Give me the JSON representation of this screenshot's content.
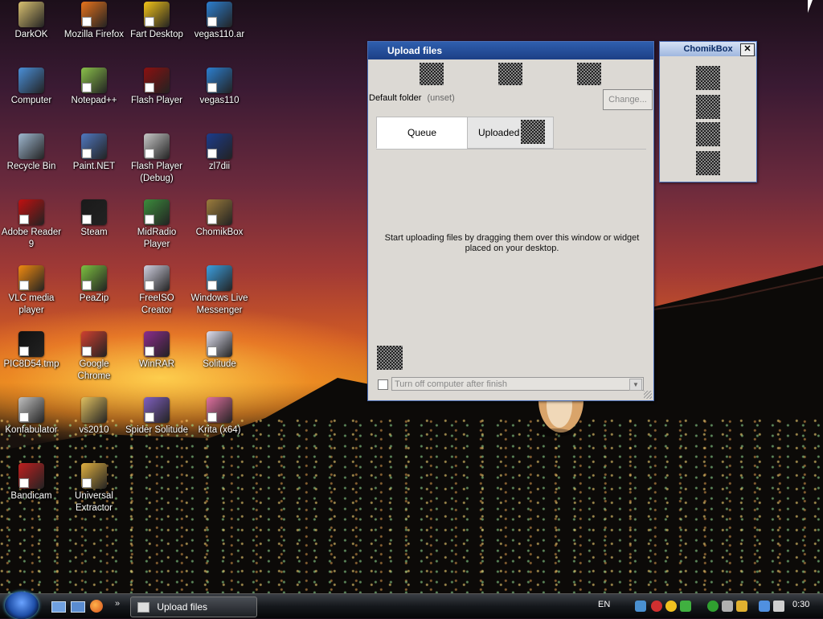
{
  "desktop": {
    "icons": [
      {
        "label": "DarkOK",
        "icon": "folder-zip-icon",
        "color": "#d8c070"
      },
      {
        "label": "Mozilla Firefox",
        "icon": "firefox-icon",
        "color": "#e8731c"
      },
      {
        "label": "Fart Desktop",
        "icon": "smiley-icon",
        "color": "#f2c318"
      },
      {
        "label": "vegas110.ar",
        "icon": "vegas-icon",
        "color": "#2c7fd0"
      },
      {
        "label": "Computer",
        "icon": "computer-icon",
        "color": "#4a8fd8"
      },
      {
        "label": "Notepad++",
        "icon": "notepad-icon",
        "color": "#8ac04a"
      },
      {
        "label": "Flash Player",
        "icon": "flash-icon",
        "color": "#8b1010"
      },
      {
        "label": "vegas110",
        "icon": "vegas-icon",
        "color": "#2c7fd0"
      },
      {
        "label": "Recycle Bin",
        "icon": "recycle-bin-icon",
        "color": "#9fb8d0"
      },
      {
        "label": "Paint.NET",
        "icon": "paint-icon",
        "color": "#5078c0"
      },
      {
        "label": "Flash Player (Debug)",
        "icon": "flash-debug-icon",
        "color": "#c8c8c8"
      },
      {
        "label": "zl7dii",
        "icon": "flash-file-icon",
        "color": "#1c3c8c"
      },
      {
        "label": "Adobe Reader 9",
        "icon": "adobe-reader-icon",
        "color": "#c01010"
      },
      {
        "label": "Steam",
        "icon": "steam-icon",
        "color": "#1a1a1a"
      },
      {
        "label": "MidRadio Player",
        "icon": "radio-icon",
        "color": "#3c8c3c"
      },
      {
        "label": "ChomikBox",
        "icon": "hamster-icon",
        "color": "#9c7c3c"
      },
      {
        "label": "VLC media player",
        "icon": "vlc-icon",
        "color": "#f08a10"
      },
      {
        "label": "PeaZip",
        "icon": "peazip-icon",
        "color": "#7cc040"
      },
      {
        "label": "FreeISO Creator",
        "icon": "iso-icon",
        "color": "#d0d0e0"
      },
      {
        "label": "Windows Live Messenger",
        "icon": "messenger-icon",
        "color": "#3ca0e0"
      },
      {
        "label": "PIC8D54.tmp",
        "icon": "tmp-file-icon",
        "color": "#101010"
      },
      {
        "label": "Google Chrome",
        "icon": "chrome-icon",
        "color": "#d04030"
      },
      {
        "label": "WinRAR",
        "icon": "winrar-icon",
        "color": "#8c2c8c"
      },
      {
        "label": "Solitude",
        "icon": "solitaire-icon",
        "color": "#e0e0f0"
      },
      {
        "label": "Konfabulator",
        "icon": "konfabulator-icon",
        "color": "#c0c0c0"
      },
      {
        "label": "vs2010",
        "icon": "folder-icon",
        "color": "#e0c060"
      },
      {
        "label": "Spider Solitude",
        "icon": "spider-icon",
        "color": "#8060c0"
      },
      {
        "label": "Krita (x64)",
        "icon": "krita-icon",
        "color": "#e070a0"
      },
      {
        "label": "Bandicam",
        "icon": "bandicam-icon",
        "color": "#c02020"
      },
      {
        "label": "Universal Extractor",
        "icon": "extractor-icon",
        "color": "#e0b040"
      }
    ]
  },
  "upload_window": {
    "title": "Upload files",
    "default_folder_label": "Default folder",
    "default_folder_value": "(unset)",
    "change_button": "Change...",
    "tabs": {
      "queue": "Queue",
      "uploaded": "Uploaded"
    },
    "message": "Start uploading files by dragging them over this window or widget placed on your desktop.",
    "shutdown_placeholder": "Turn off computer after finish"
  },
  "widget": {
    "title": "ChomikBox"
  },
  "taskbar": {
    "task_label": "Upload files",
    "language": "EN",
    "clock": "0:30"
  }
}
